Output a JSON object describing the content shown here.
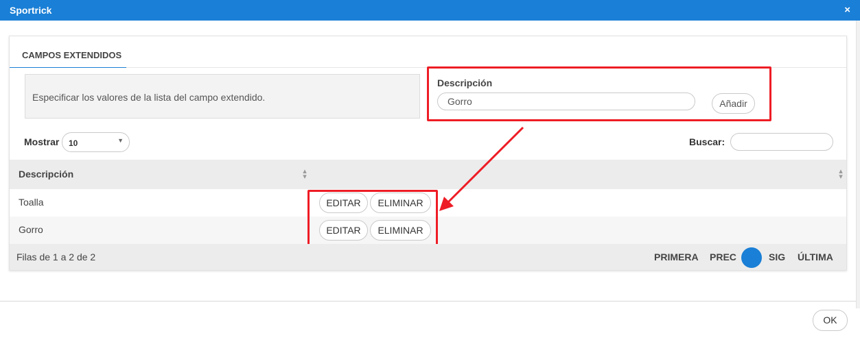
{
  "window": {
    "title": "Sportrick",
    "close_icon": "×"
  },
  "tab": {
    "label": "CAMPOS EXTENDIDOS"
  },
  "info_text": "Especificar los valores de la lista del campo extendido.",
  "form": {
    "label": "Descripción",
    "value": "Gorro",
    "add_label": "Añadir"
  },
  "table_controls": {
    "show_label": "Mostrar",
    "page_size": "10",
    "search_label": "Buscar:",
    "search_value": ""
  },
  "table": {
    "columns": [
      "Descripción",
      ""
    ],
    "rows": [
      {
        "descripcion": "Toalla",
        "edit_label": "EDITAR",
        "delete_label": "ELIMINAR"
      },
      {
        "descripcion": "Gorro",
        "edit_label": "EDITAR",
        "delete_label": "ELIMINAR"
      }
    ],
    "footer_info": "Filas de 1 a 2 de 2"
  },
  "pagination": {
    "first": "PRIMERA",
    "prev": "PREC",
    "current": "1",
    "next": "SIG",
    "last": "ÚLTIMA"
  },
  "footer": {
    "ok_label": "OK"
  },
  "colors": {
    "accent": "#1a7fd6",
    "annotation": "#ee1c25"
  }
}
